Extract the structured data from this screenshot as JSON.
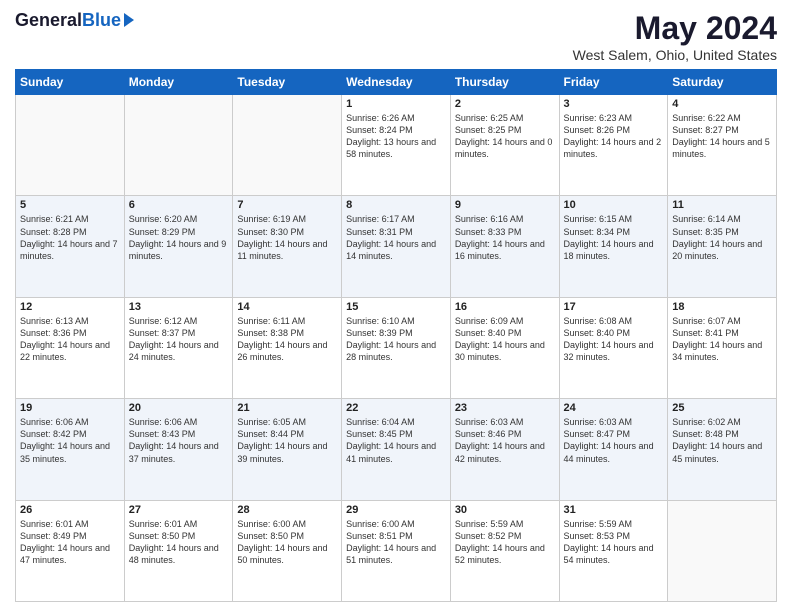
{
  "logo": {
    "general": "General",
    "blue": "Blue"
  },
  "title": "May 2024",
  "subtitle": "West Salem, Ohio, United States",
  "headers": [
    "Sunday",
    "Monday",
    "Tuesday",
    "Wednesday",
    "Thursday",
    "Friday",
    "Saturday"
  ],
  "weeks": [
    [
      {
        "day": "",
        "sunrise": "",
        "sunset": "",
        "daylight": "",
        "empty": true
      },
      {
        "day": "",
        "sunrise": "",
        "sunset": "",
        "daylight": "",
        "empty": true
      },
      {
        "day": "",
        "sunrise": "",
        "sunset": "",
        "daylight": "",
        "empty": true
      },
      {
        "day": "1",
        "sunrise": "Sunrise: 6:26 AM",
        "sunset": "Sunset: 8:24 PM",
        "daylight": "Daylight: 13 hours and 58 minutes."
      },
      {
        "day": "2",
        "sunrise": "Sunrise: 6:25 AM",
        "sunset": "Sunset: 8:25 PM",
        "daylight": "Daylight: 14 hours and 0 minutes."
      },
      {
        "day": "3",
        "sunrise": "Sunrise: 6:23 AM",
        "sunset": "Sunset: 8:26 PM",
        "daylight": "Daylight: 14 hours and 2 minutes."
      },
      {
        "day": "4",
        "sunrise": "Sunrise: 6:22 AM",
        "sunset": "Sunset: 8:27 PM",
        "daylight": "Daylight: 14 hours and 5 minutes."
      }
    ],
    [
      {
        "day": "5",
        "sunrise": "Sunrise: 6:21 AM",
        "sunset": "Sunset: 8:28 PM",
        "daylight": "Daylight: 14 hours and 7 minutes."
      },
      {
        "day": "6",
        "sunrise": "Sunrise: 6:20 AM",
        "sunset": "Sunset: 8:29 PM",
        "daylight": "Daylight: 14 hours and 9 minutes."
      },
      {
        "day": "7",
        "sunrise": "Sunrise: 6:19 AM",
        "sunset": "Sunset: 8:30 PM",
        "daylight": "Daylight: 14 hours and 11 minutes."
      },
      {
        "day": "8",
        "sunrise": "Sunrise: 6:17 AM",
        "sunset": "Sunset: 8:31 PM",
        "daylight": "Daylight: 14 hours and 14 minutes."
      },
      {
        "day": "9",
        "sunrise": "Sunrise: 6:16 AM",
        "sunset": "Sunset: 8:33 PM",
        "daylight": "Daylight: 14 hours and 16 minutes."
      },
      {
        "day": "10",
        "sunrise": "Sunrise: 6:15 AM",
        "sunset": "Sunset: 8:34 PM",
        "daylight": "Daylight: 14 hours and 18 minutes."
      },
      {
        "day": "11",
        "sunrise": "Sunrise: 6:14 AM",
        "sunset": "Sunset: 8:35 PM",
        "daylight": "Daylight: 14 hours and 20 minutes."
      }
    ],
    [
      {
        "day": "12",
        "sunrise": "Sunrise: 6:13 AM",
        "sunset": "Sunset: 8:36 PM",
        "daylight": "Daylight: 14 hours and 22 minutes."
      },
      {
        "day": "13",
        "sunrise": "Sunrise: 6:12 AM",
        "sunset": "Sunset: 8:37 PM",
        "daylight": "Daylight: 14 hours and 24 minutes."
      },
      {
        "day": "14",
        "sunrise": "Sunrise: 6:11 AM",
        "sunset": "Sunset: 8:38 PM",
        "daylight": "Daylight: 14 hours and 26 minutes."
      },
      {
        "day": "15",
        "sunrise": "Sunrise: 6:10 AM",
        "sunset": "Sunset: 8:39 PM",
        "daylight": "Daylight: 14 hours and 28 minutes."
      },
      {
        "day": "16",
        "sunrise": "Sunrise: 6:09 AM",
        "sunset": "Sunset: 8:40 PM",
        "daylight": "Daylight: 14 hours and 30 minutes."
      },
      {
        "day": "17",
        "sunrise": "Sunrise: 6:08 AM",
        "sunset": "Sunset: 8:40 PM",
        "daylight": "Daylight: 14 hours and 32 minutes."
      },
      {
        "day": "18",
        "sunrise": "Sunrise: 6:07 AM",
        "sunset": "Sunset: 8:41 PM",
        "daylight": "Daylight: 14 hours and 34 minutes."
      }
    ],
    [
      {
        "day": "19",
        "sunrise": "Sunrise: 6:06 AM",
        "sunset": "Sunset: 8:42 PM",
        "daylight": "Daylight: 14 hours and 35 minutes."
      },
      {
        "day": "20",
        "sunrise": "Sunrise: 6:06 AM",
        "sunset": "Sunset: 8:43 PM",
        "daylight": "Daylight: 14 hours and 37 minutes."
      },
      {
        "day": "21",
        "sunrise": "Sunrise: 6:05 AM",
        "sunset": "Sunset: 8:44 PM",
        "daylight": "Daylight: 14 hours and 39 minutes."
      },
      {
        "day": "22",
        "sunrise": "Sunrise: 6:04 AM",
        "sunset": "Sunset: 8:45 PM",
        "daylight": "Daylight: 14 hours and 41 minutes."
      },
      {
        "day": "23",
        "sunrise": "Sunrise: 6:03 AM",
        "sunset": "Sunset: 8:46 PM",
        "daylight": "Daylight: 14 hours and 42 minutes."
      },
      {
        "day": "24",
        "sunrise": "Sunrise: 6:03 AM",
        "sunset": "Sunset: 8:47 PM",
        "daylight": "Daylight: 14 hours and 44 minutes."
      },
      {
        "day": "25",
        "sunrise": "Sunrise: 6:02 AM",
        "sunset": "Sunset: 8:48 PM",
        "daylight": "Daylight: 14 hours and 45 minutes."
      }
    ],
    [
      {
        "day": "26",
        "sunrise": "Sunrise: 6:01 AM",
        "sunset": "Sunset: 8:49 PM",
        "daylight": "Daylight: 14 hours and 47 minutes."
      },
      {
        "day": "27",
        "sunrise": "Sunrise: 6:01 AM",
        "sunset": "Sunset: 8:50 PM",
        "daylight": "Daylight: 14 hours and 48 minutes."
      },
      {
        "day": "28",
        "sunrise": "Sunrise: 6:00 AM",
        "sunset": "Sunset: 8:50 PM",
        "daylight": "Daylight: 14 hours and 50 minutes."
      },
      {
        "day": "29",
        "sunrise": "Sunrise: 6:00 AM",
        "sunset": "Sunset: 8:51 PM",
        "daylight": "Daylight: 14 hours and 51 minutes."
      },
      {
        "day": "30",
        "sunrise": "Sunrise: 5:59 AM",
        "sunset": "Sunset: 8:52 PM",
        "daylight": "Daylight: 14 hours and 52 minutes."
      },
      {
        "day": "31",
        "sunrise": "Sunrise: 5:59 AM",
        "sunset": "Sunset: 8:53 PM",
        "daylight": "Daylight: 14 hours and 54 minutes."
      },
      {
        "day": "",
        "sunrise": "",
        "sunset": "",
        "daylight": "",
        "empty": true
      }
    ]
  ]
}
